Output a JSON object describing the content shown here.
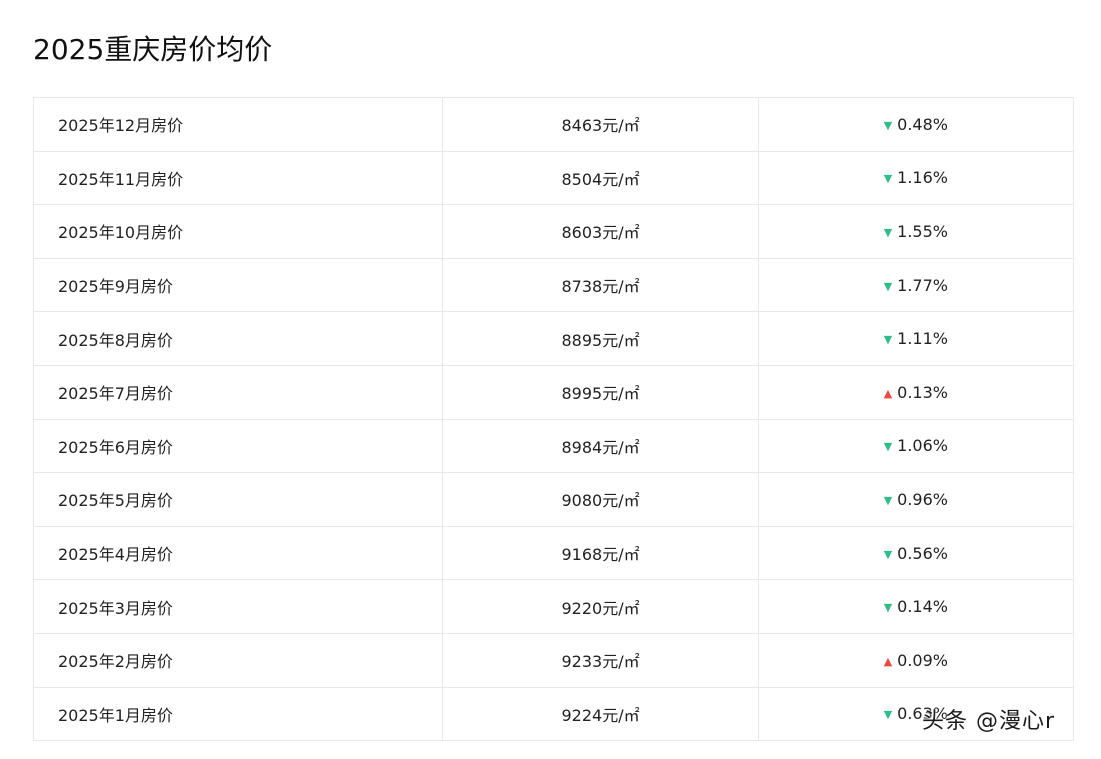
{
  "page": {
    "title": "2025重庆房价均价"
  },
  "colors": {
    "down": "#2fbf86",
    "up": "#f0483e"
  },
  "table": {
    "rows": [
      {
        "month": "2025年12月房价",
        "price": "8463元/㎡",
        "direction": "down",
        "change": "0.48%"
      },
      {
        "month": "2025年11月房价",
        "price": "8504元/㎡",
        "direction": "down",
        "change": "1.16%"
      },
      {
        "month": "2025年10月房价",
        "price": "8603元/㎡",
        "direction": "down",
        "change": "1.55%"
      },
      {
        "month": "2025年9月房价",
        "price": "8738元/㎡",
        "direction": "down",
        "change": "1.77%"
      },
      {
        "month": "2025年8月房价",
        "price": "8895元/㎡",
        "direction": "down",
        "change": "1.11%"
      },
      {
        "month": "2025年7月房价",
        "price": "8995元/㎡",
        "direction": "up",
        "change": "0.13%"
      },
      {
        "month": "2025年6月房价",
        "price": "8984元/㎡",
        "direction": "down",
        "change": "1.06%"
      },
      {
        "month": "2025年5月房价",
        "price": "9080元/㎡",
        "direction": "down",
        "change": "0.96%"
      },
      {
        "month": "2025年4月房价",
        "price": "9168元/㎡",
        "direction": "down",
        "change": "0.56%"
      },
      {
        "month": "2025年3月房价",
        "price": "9220元/㎡",
        "direction": "down",
        "change": "0.14%"
      },
      {
        "month": "2025年2月房价",
        "price": "9233元/㎡",
        "direction": "up",
        "change": "0.09%"
      },
      {
        "month": "2025年1月房价",
        "price": "9224元/㎡",
        "direction": "down",
        "change": "0.63%"
      }
    ]
  },
  "watermark": {
    "text": "头条 @漫心r"
  }
}
